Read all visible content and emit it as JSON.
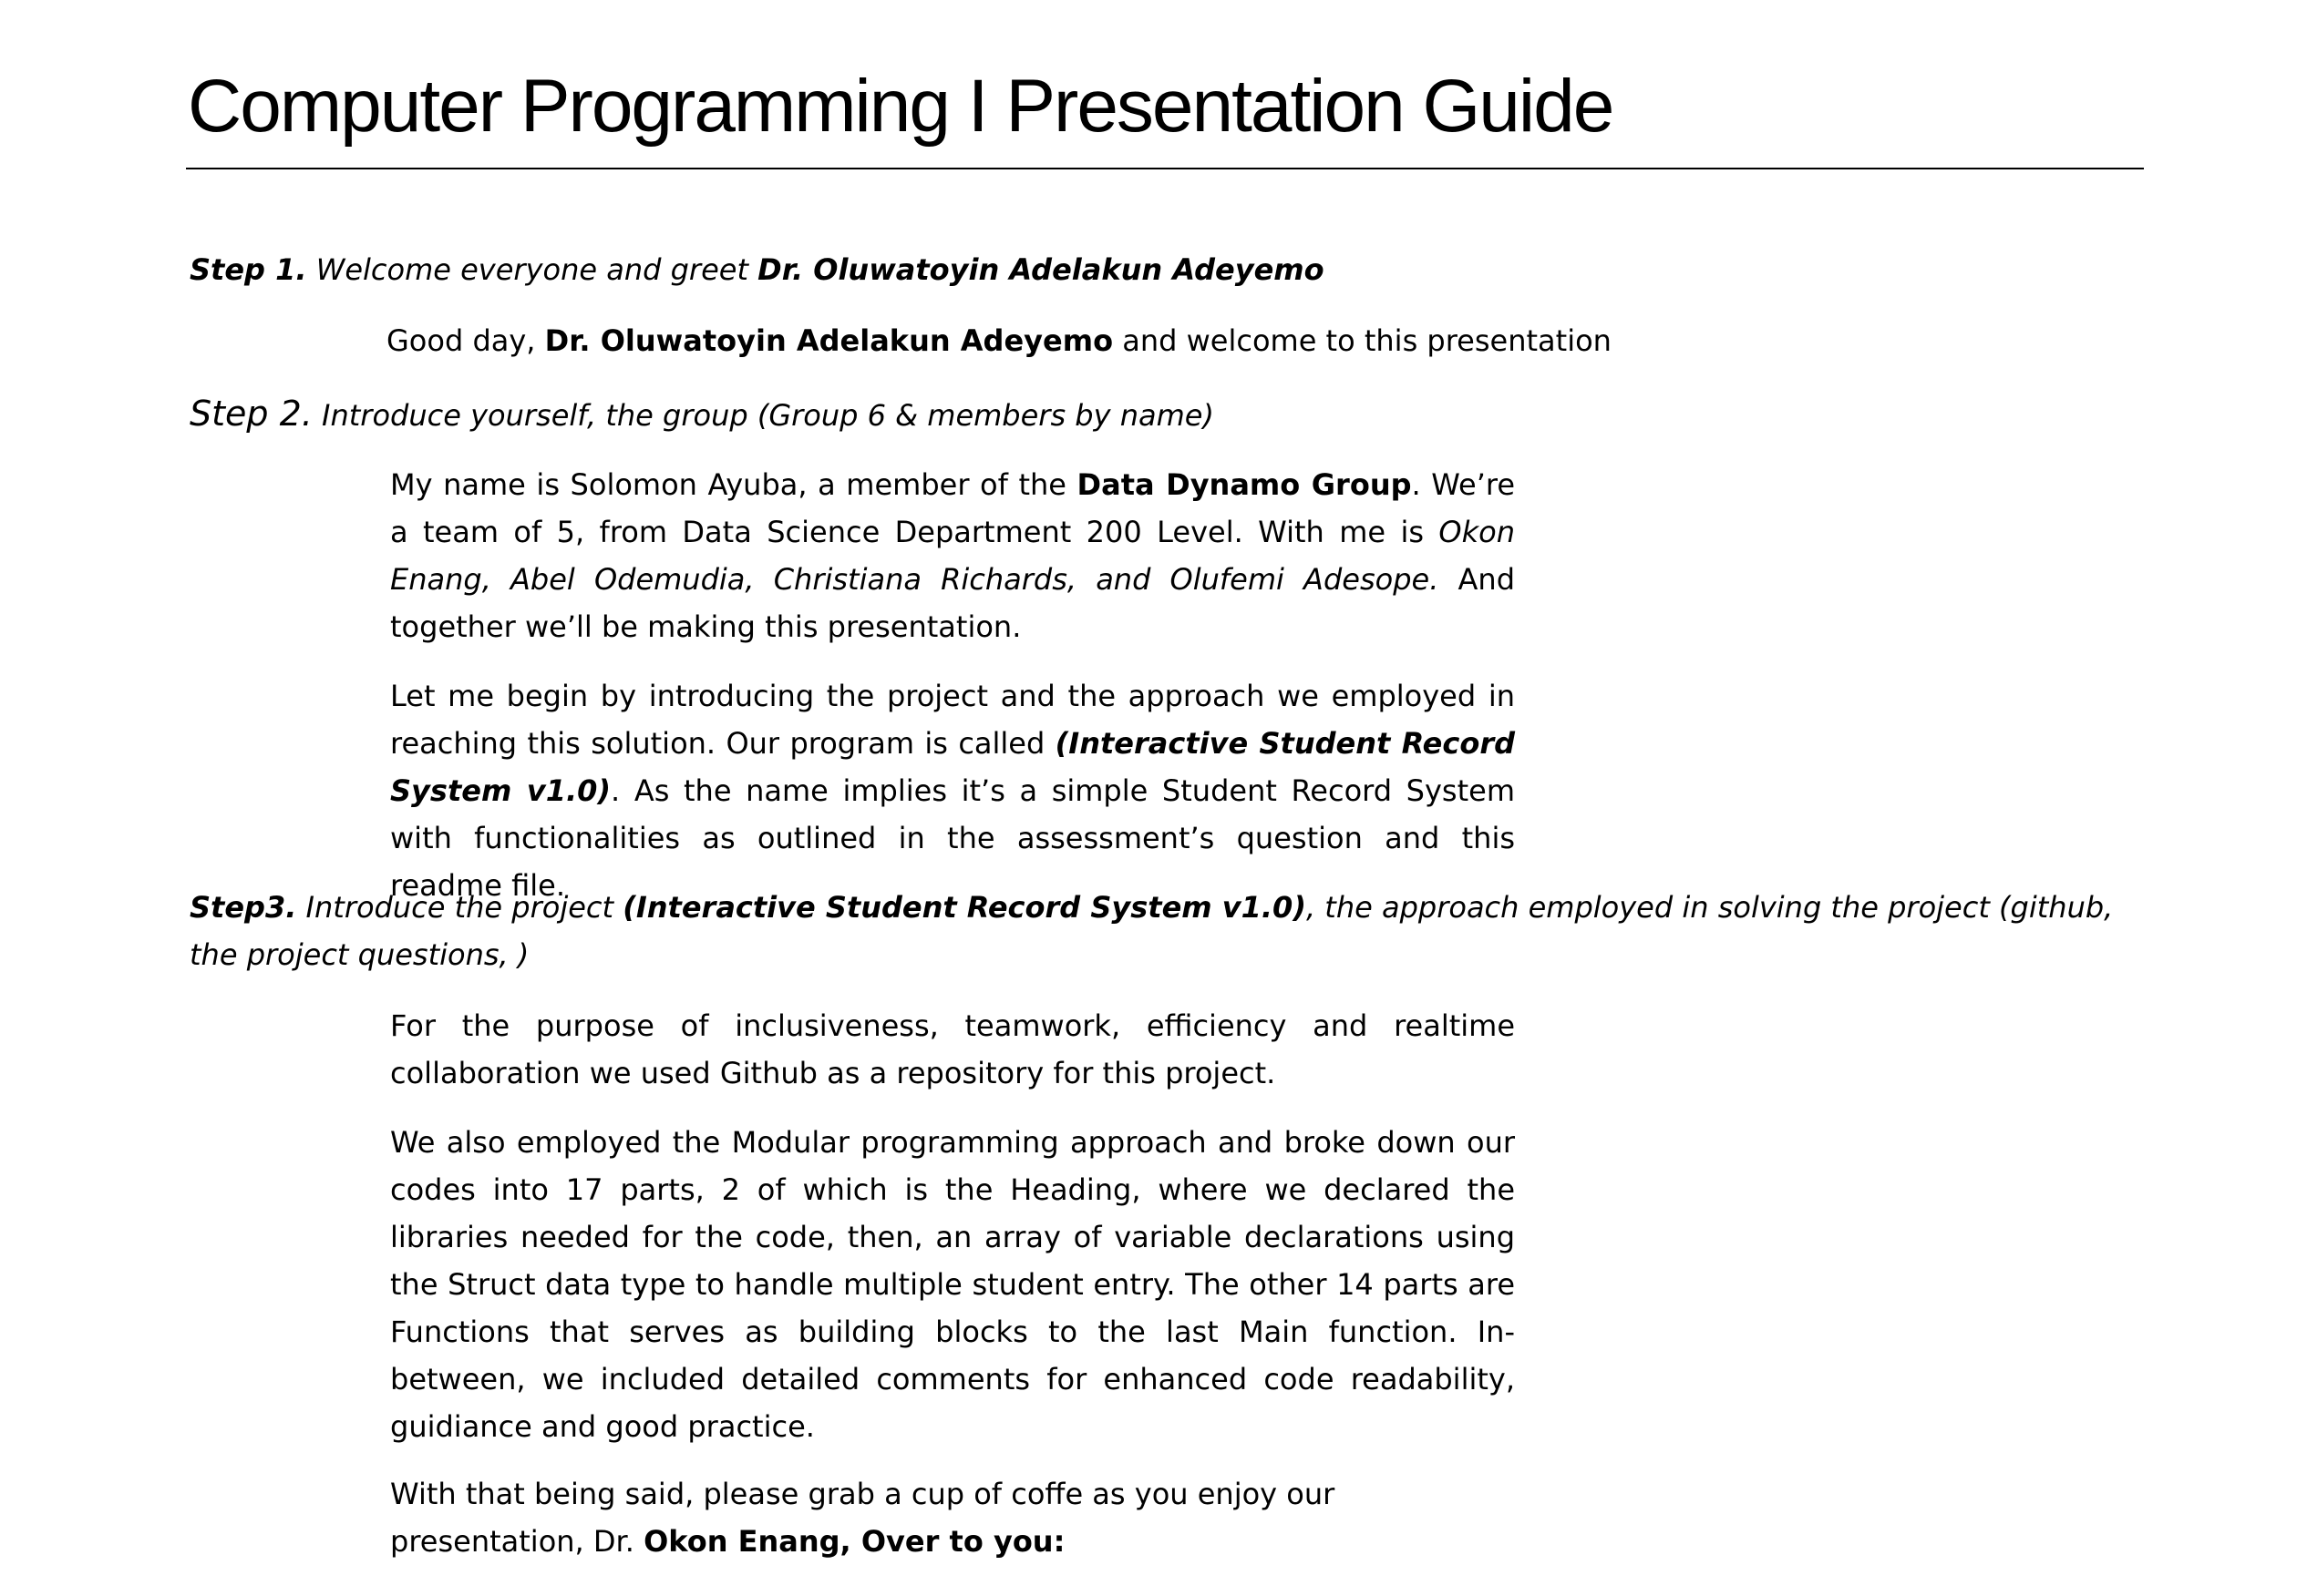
{
  "title": "Computer Programming I Presentation Guide",
  "step1": {
    "label": "Step 1.",
    "text": " Welcome everyone and greet ",
    "name": "Dr. Oluwatoyin Adelakun Adeyemo"
  },
  "greeting": {
    "pre": "Good day, ",
    "name": "Dr. Oluwatoyin Adelakun Adeyemo",
    "post": " and welcome to this presentation"
  },
  "step2": {
    "label": "Step 2.",
    "text": " Introduce yourself, the group (Group 6 & members by name)"
  },
  "intro": {
    "pre": "My name is Solomon Ayuba, a member of the ",
    "group": "Data Dynamo Group",
    "mid": ". We’re a team of 5, from Data Science Department 200 Level. With me is ",
    "members": "Okon Enang, Abel Odemudia, Christiana Richards, and Olufemi Adesope.",
    "post": " And together we’ll be making this presentation."
  },
  "project_intro": {
    "pre": "Let me begin by introducing the project and the approach we employed in reaching this solution.  Our program is called ",
    "program": "(Interactive Student Record System v1.0)",
    "post": ". As the name implies it’s a simple Student Record System with functionalities as outlined in the assessment’s question and this readme file."
  },
  "step3": {
    "label": "Step3.",
    "pre": " Introduce the project ",
    "program": "(Interactive Student Record System v1.0)",
    "post": ", the approach employed in solving the project (github, the project questions, )"
  },
  "github_para": "For the purpose of inclusiveness, teamwork, efficiency and realtime collaboration we used Github as a repository for this project.",
  "modular_para": "We also employed the Modular programming approach and broke down our codes into 17 parts, 2 of which is the Heading, where we declared the libraries needed for the code, then, an array of variable declarations using the Struct data type to handle multiple student entry. The other 14 parts are Functions that serves as building blocks to the last Main function. In-between, we included detailed comments for enhanced code readability, guidiance and good practice.",
  "closing": {
    "pre": "With that being said, please grab a cup of coffe as you enjoy our presentation, Dr. ",
    "handoff": "Okon Enang, Over to you:"
  }
}
